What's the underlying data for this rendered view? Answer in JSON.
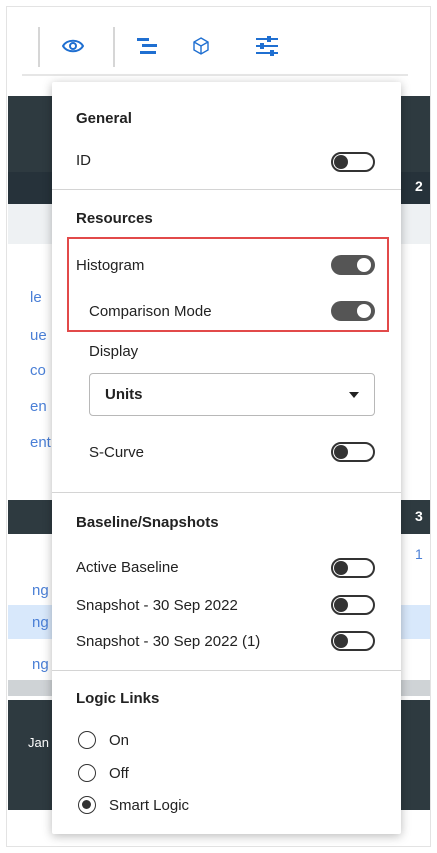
{
  "toolbar": {
    "icons": [
      "eye-icon",
      "gantt-bars-icon",
      "cube-icon",
      "sliders-icon"
    ],
    "accent": "#1f6fd1"
  },
  "background": {
    "links": [
      "le",
      "ue",
      "co",
      "en",
      "ent"
    ],
    "lower_links": [
      "ng",
      "ng",
      "ng"
    ],
    "right_numbers": [
      "2",
      "3",
      "1"
    ],
    "name_fragment": "Jan"
  },
  "panel": {
    "general": {
      "title": "General",
      "rows": [
        {
          "label": "ID",
          "state": "off"
        }
      ]
    },
    "resources": {
      "title": "Resources",
      "histogram": {
        "label": "Histogram",
        "state": "on"
      },
      "comparison_mode": {
        "label": "Comparison Mode",
        "state": "on"
      },
      "display_label": "Display",
      "display_value": "Units",
      "s_curve": {
        "label": "S-Curve",
        "state": "off"
      }
    },
    "baseline": {
      "title": "Baseline/Snapshots",
      "rows": [
        {
          "label": "Active Baseline",
          "state": "off"
        },
        {
          "label": "Snapshot - 30 Sep 2022",
          "state": "off"
        },
        {
          "label": "Snapshot - 30 Sep 2022 (1)",
          "state": "off"
        }
      ]
    },
    "logic_links": {
      "title": "Logic Links",
      "options": [
        {
          "label": "On",
          "checked": false
        },
        {
          "label": "Off",
          "checked": false
        },
        {
          "label": "Smart Logic",
          "checked": true
        }
      ]
    },
    "highlight_color": "#e24a4a"
  }
}
